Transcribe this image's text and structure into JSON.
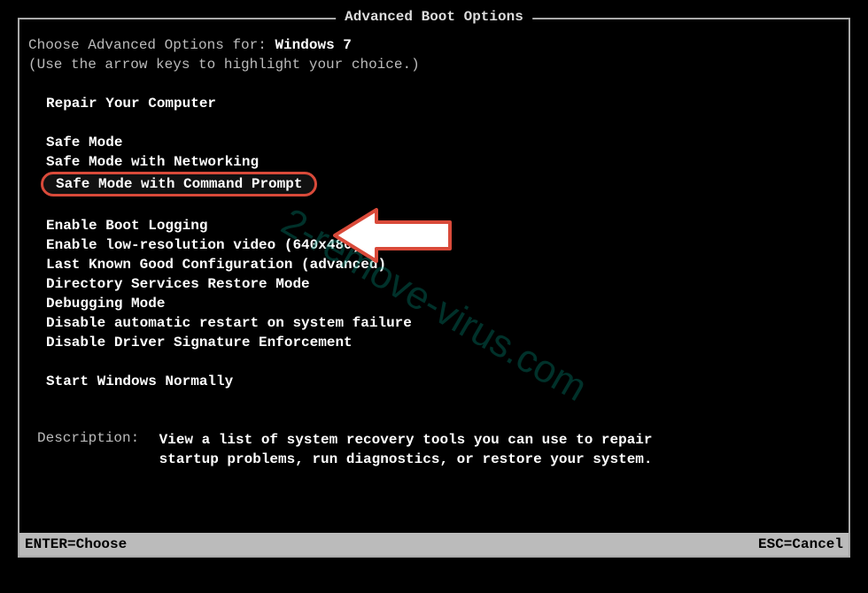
{
  "title": "Advanced Boot Options",
  "header": {
    "choose_label": "Choose Advanced Options for: ",
    "os_name": "Windows 7",
    "hint": "(Use the arrow keys to highlight your choice.)"
  },
  "groups": {
    "repair": {
      "item": "Repair Your Computer"
    },
    "safe": {
      "item1": "Safe Mode",
      "item2": "Safe Mode with Networking",
      "item3_selected": "Safe Mode with Command Prompt"
    },
    "other": {
      "item1": "Enable Boot Logging",
      "item2": "Enable low-resolution video (640x480)",
      "item3": "Last Known Good Configuration (advanced)",
      "item4": "Directory Services Restore Mode",
      "item5": "Debugging Mode",
      "item6": "Disable automatic restart on system failure",
      "item7": "Disable Driver Signature Enforcement"
    },
    "normal": {
      "item": "Start Windows Normally"
    }
  },
  "description": {
    "label": "Description:",
    "text": "View a list of system recovery tools you can use to repair startup problems, run diagnostics, or restore your system."
  },
  "footer": {
    "left": "ENTER=Choose",
    "right": "ESC=Cancel"
  },
  "watermark": "2-remove-virus.com"
}
